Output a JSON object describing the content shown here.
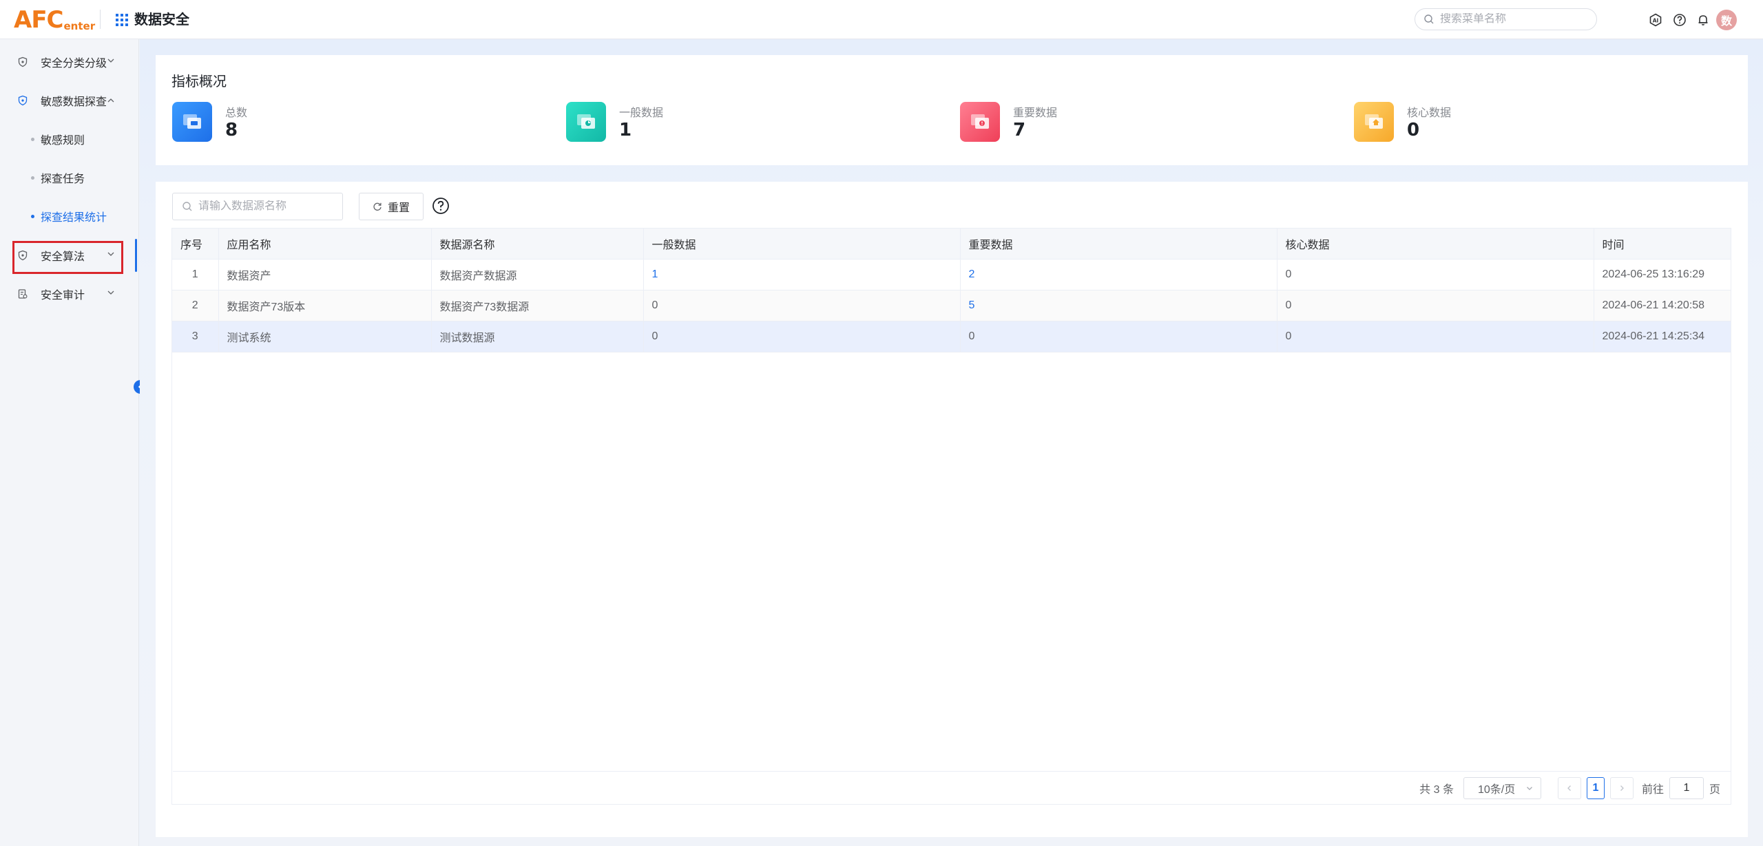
{
  "header": {
    "logo_big": "AFC",
    "logo_small": "enter",
    "app_title": "数据安全",
    "search_placeholder": "搜索菜单名称",
    "avatar_text": "数"
  },
  "sidebar": {
    "items": [
      {
        "label": "安全分类分级"
      },
      {
        "label": "敏感数据探查"
      },
      {
        "label": "敏感规则"
      },
      {
        "label": "探查任务"
      },
      {
        "label": "探查结果统计"
      },
      {
        "label": "安全算法"
      },
      {
        "label": "安全审计"
      }
    ]
  },
  "overview": {
    "title": "指标概况",
    "stats": [
      {
        "label": "总数",
        "value": "8",
        "color": "#1e6fe8"
      },
      {
        "label": "一般数据",
        "value": "1",
        "color": "#17c8b5"
      },
      {
        "label": "重要数据",
        "value": "7",
        "color": "#f2536a"
      },
      {
        "label": "核心数据",
        "value": "0",
        "color": "#fbb43f"
      }
    ]
  },
  "filter": {
    "placeholder": "请输入数据源名称",
    "reset_label": "重置"
  },
  "table": {
    "columns": [
      "序号",
      "应用名称",
      "数据源名称",
      "一般数据",
      "重要数据",
      "核心数据",
      "时间"
    ],
    "rows": [
      [
        "1",
        "数据资产",
        "数据资产数据源",
        "1",
        "2",
        "0",
        "2024-06-25 13:16:29"
      ],
      [
        "2",
        "数据资产73版本",
        "数据资产73数据源",
        "0",
        "5",
        "0",
        "2024-06-21 14:20:58"
      ],
      [
        "3",
        "测试系统",
        "测试数据源",
        "0",
        "0",
        "0",
        "2024-06-21 14:25:34"
      ]
    ]
  },
  "pagination": {
    "total": "共 3 条",
    "page_size": "10条/页",
    "current_page": "1",
    "goto_label": "前往",
    "goto_value": "1",
    "page_unit": "页"
  },
  "colors": {
    "accent": "#1e6fe8",
    "highlight_border": "#d9262c",
    "logo": "#f07a1a"
  }
}
